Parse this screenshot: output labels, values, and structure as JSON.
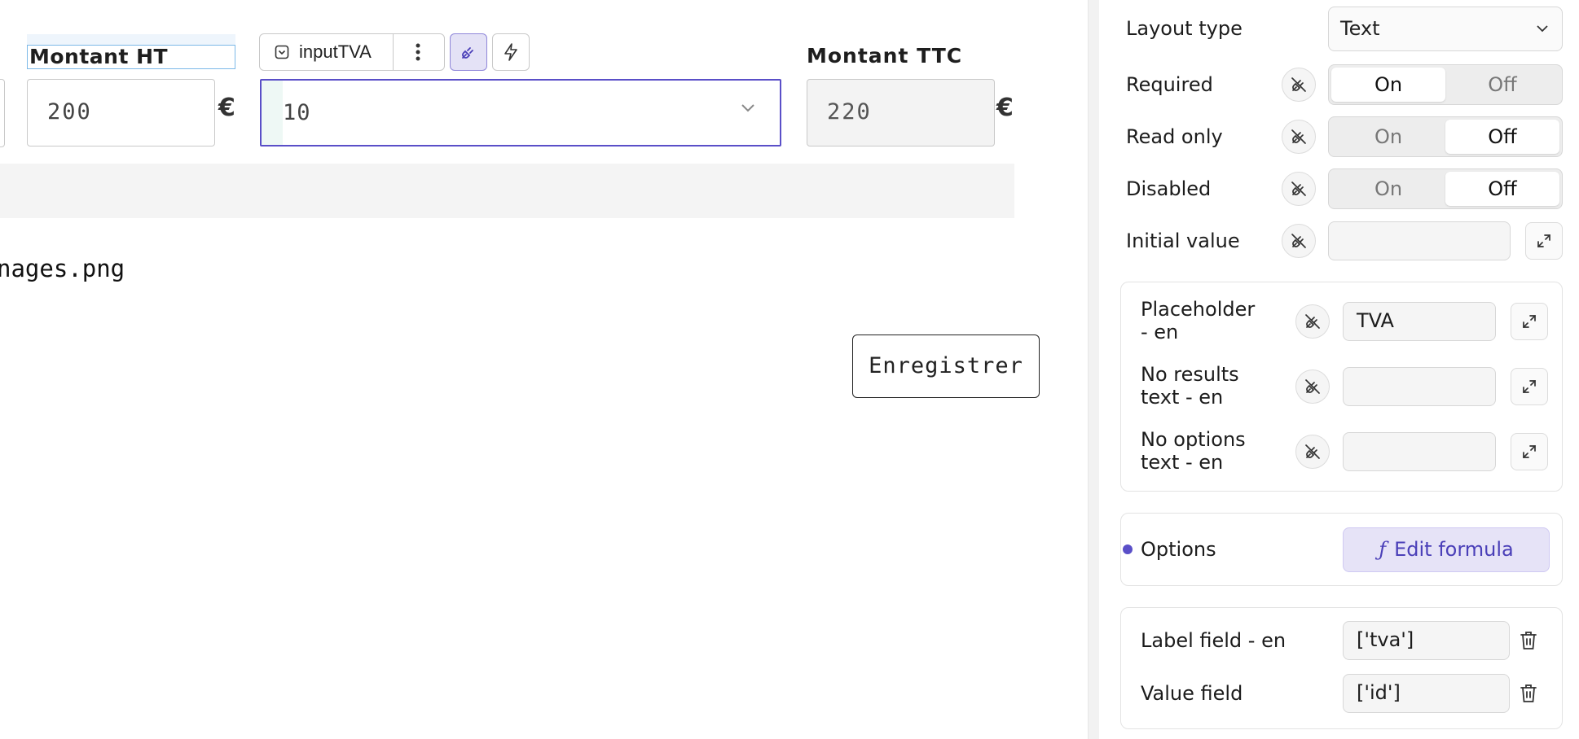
{
  "canvas": {
    "montant_ht_label": "Montant HT",
    "montant_ht_value": "200",
    "currency": "€",
    "component_name": "inputTVA",
    "tva_value": "10",
    "montant_ttc_label": "Montant TTC",
    "montant_ttc_value": "220",
    "filename": "nages.png",
    "save_button": "Enregistrer"
  },
  "panel": {
    "layout_type": {
      "label": "Layout type",
      "value": "Text"
    },
    "required": {
      "label": "Required",
      "on": "On",
      "off": "Off",
      "selected": "On"
    },
    "read_only": {
      "label": "Read only",
      "on": "On",
      "off": "Off",
      "selected": "Off"
    },
    "disabled": {
      "label": "Disabled",
      "on": "On",
      "off": "Off",
      "selected": "Off"
    },
    "initial_value": {
      "label": "Initial value",
      "value": ""
    },
    "placeholder": {
      "label": "Placeholder - en",
      "value": "TVA"
    },
    "no_results": {
      "label": "No results text - en",
      "value": ""
    },
    "no_options": {
      "label": "No options text - en",
      "value": ""
    },
    "options": {
      "label": "Options",
      "button": "Edit formula",
      "button_icon": "ƒ"
    },
    "label_field": {
      "label": "Label field - en",
      "value": "['tva']"
    },
    "value_field": {
      "label": "Value field",
      "value": "['id']"
    }
  },
  "colors": {
    "accent": "#5a4fc8",
    "accent_bg": "#e6e3f7",
    "selection_outline": "#7cb9e8"
  }
}
